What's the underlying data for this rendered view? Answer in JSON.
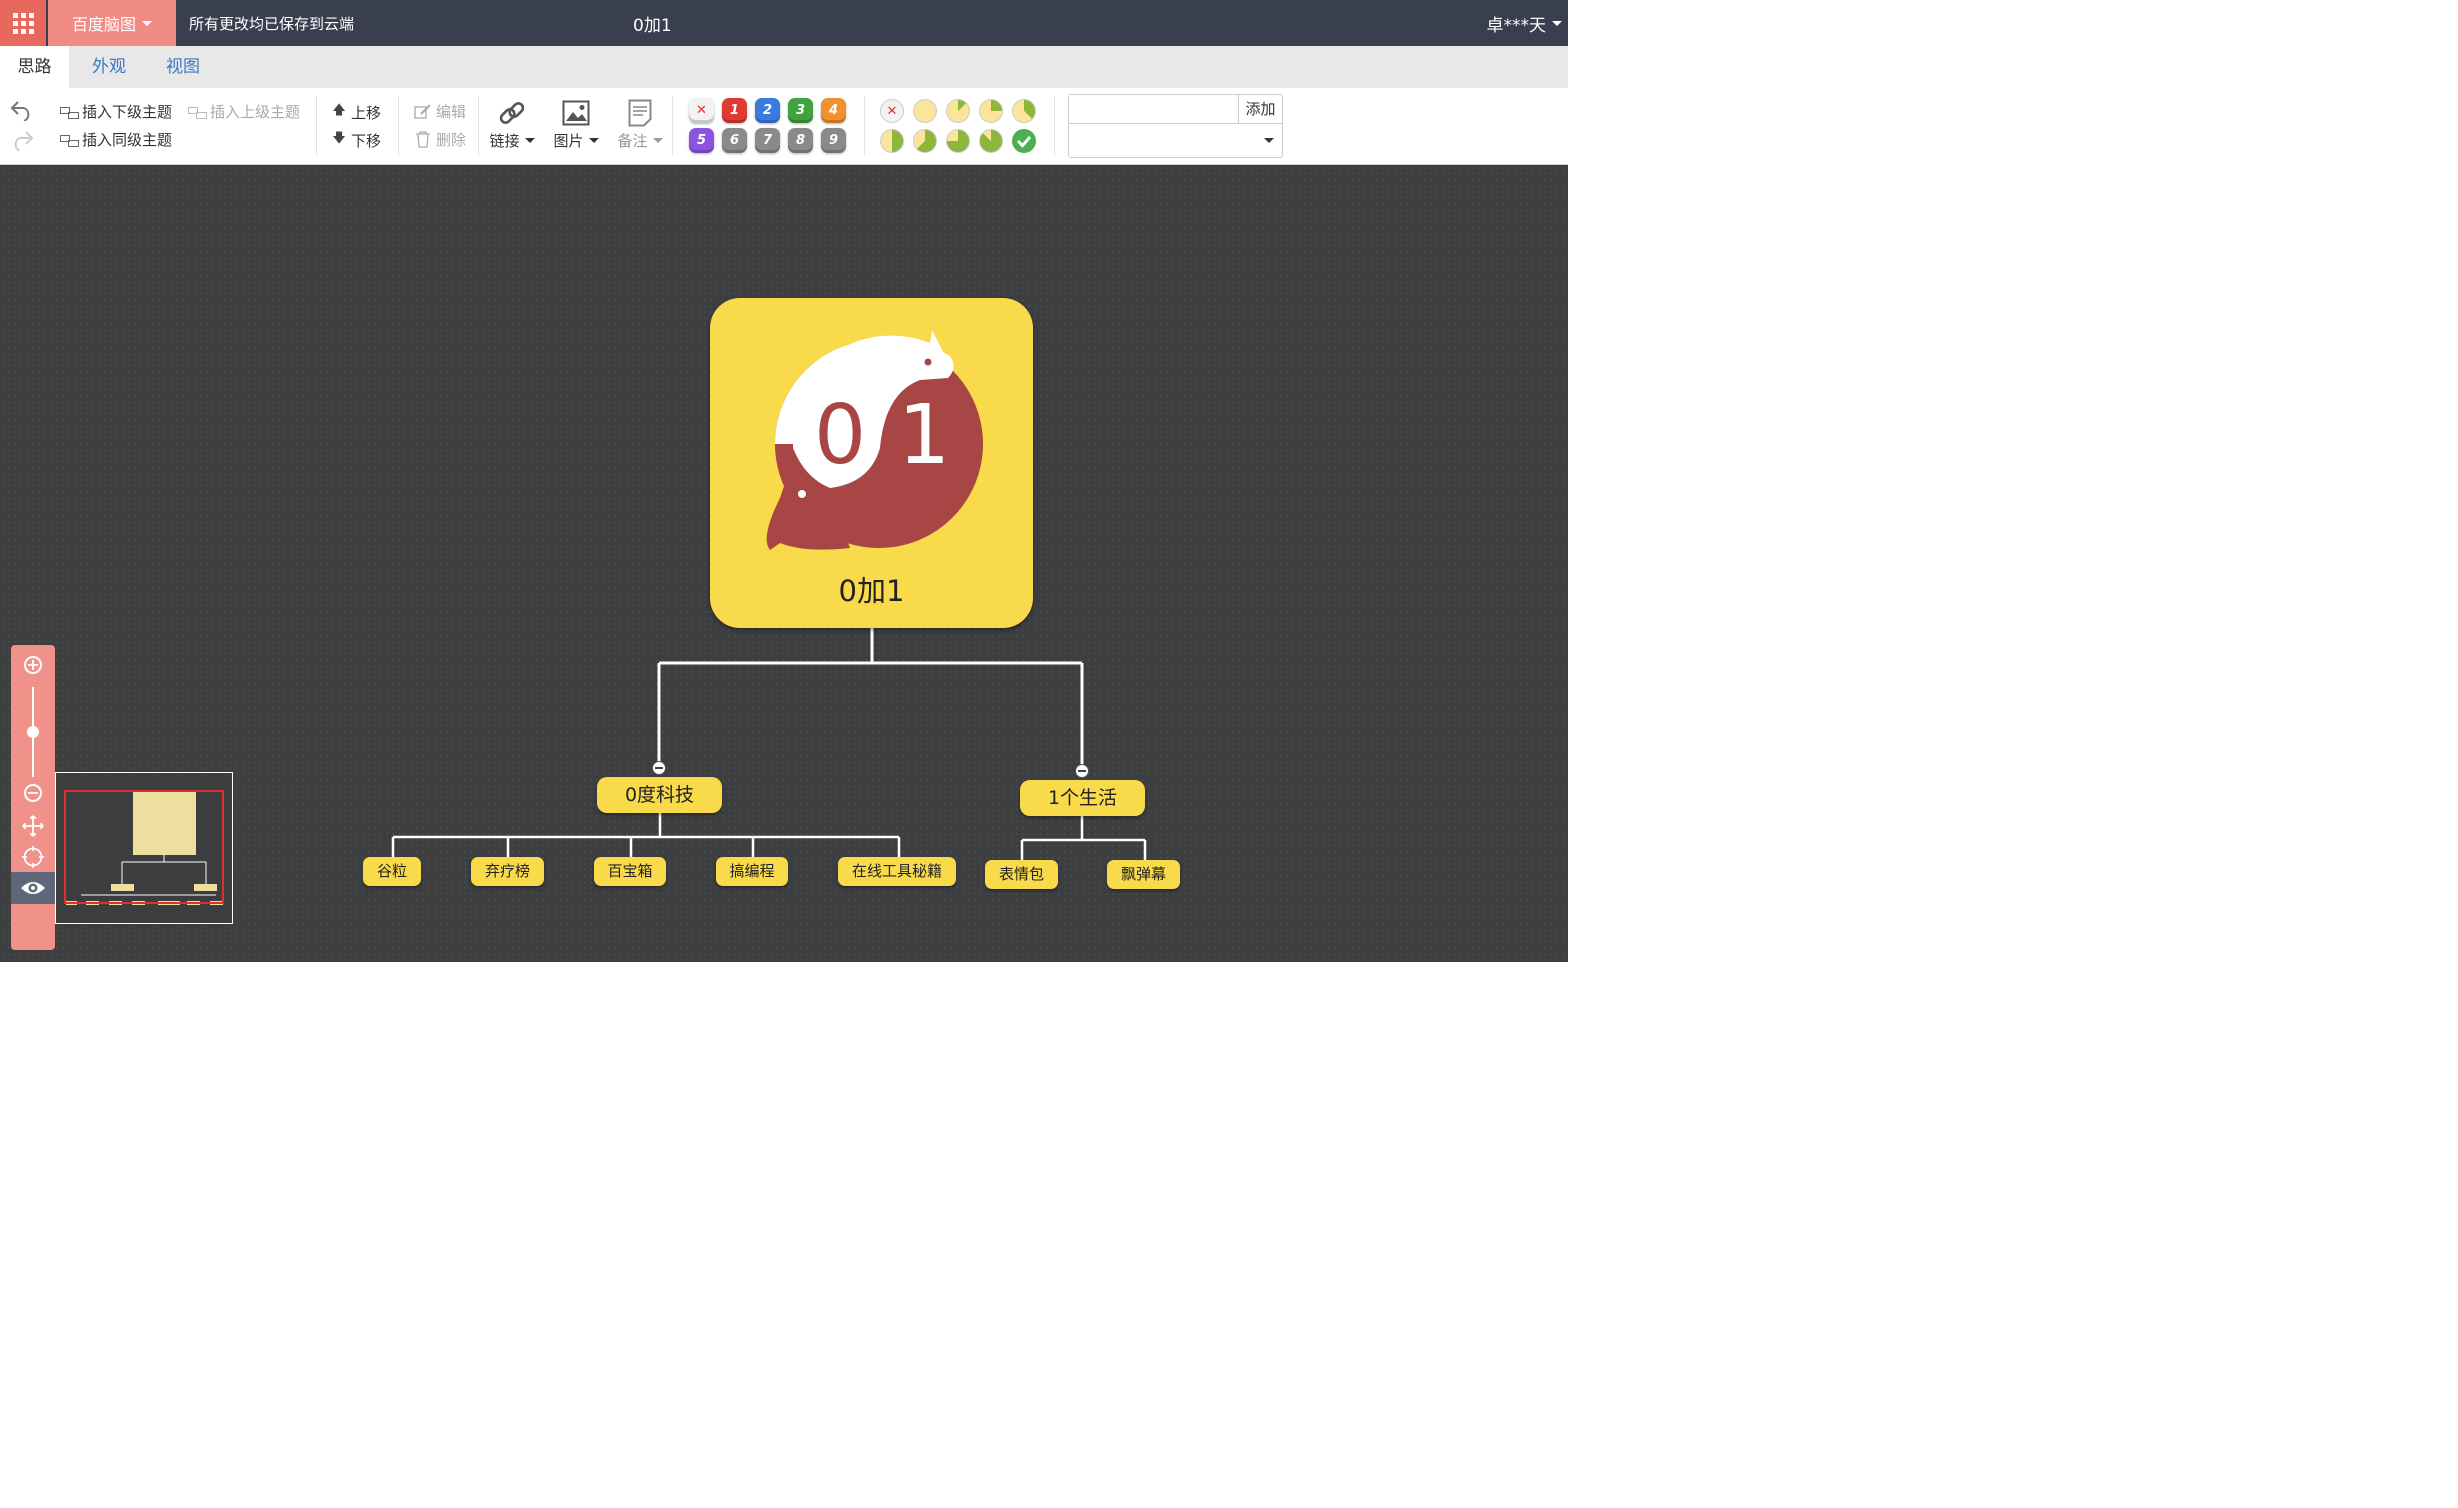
{
  "topbar": {
    "apps_icon": "apps-grid-icon",
    "brand": "百度脑图",
    "save_status": "所有更改均已保存到云端",
    "title": "0加1",
    "user": "卓***天"
  },
  "tabs": [
    {
      "label": "思路",
      "active": true
    },
    {
      "label": "外观",
      "active": false
    },
    {
      "label": "视图",
      "active": false
    }
  ],
  "toolbar": {
    "undo_icon": "undo-icon",
    "redo_icon": "redo-icon",
    "insert_child": "插入下级主题",
    "insert_parent": "插入上级主题",
    "insert_sibling": "插入同级主题",
    "move_up": "上移",
    "move_down": "下移",
    "edit": "编辑",
    "delete": "删除",
    "link": "链接",
    "image": "图片",
    "note": "备注",
    "priorities": [
      "1",
      "2",
      "3",
      "4",
      "5",
      "6",
      "7",
      "8",
      "9"
    ],
    "priority_colors": [
      "#e03a32",
      "#3a7be0",
      "#3fa33f",
      "#f0902e",
      "#8c52e0",
      "#8a8a8a",
      "#8a8a8a",
      "#8a8a8a",
      "#8a8a8a"
    ],
    "progress_levels": [
      0,
      0.125,
      0.25,
      0.375,
      0.5,
      0.625,
      0.75,
      0.875,
      1
    ],
    "tag_add": "添加",
    "tag_input_value": "",
    "tag_select_value": ""
  },
  "mindmap": {
    "root": {
      "label": "0加1",
      "logo_text_left": "0",
      "logo_text_right": "1"
    },
    "branches": [
      {
        "label": "0度科技",
        "children": [
          "谷粒",
          "弃疗榜",
          "百宝箱",
          "搞编程",
          "在线工具秘籍"
        ]
      },
      {
        "label": "1个生活",
        "children": [
          "表情包",
          "飘弹幕"
        ]
      }
    ],
    "colors": {
      "node": "#f9da4a",
      "logo_red": "#a84545",
      "canvas": "#3c3e40"
    }
  },
  "zoom": {
    "zoom_in_icon": "zoom-in-icon",
    "zoom_out_icon": "zoom-out-icon",
    "move_icon": "move-icon",
    "locate_icon": "locate-icon",
    "eye_icon": "eye-icon",
    "level": 0.5
  }
}
